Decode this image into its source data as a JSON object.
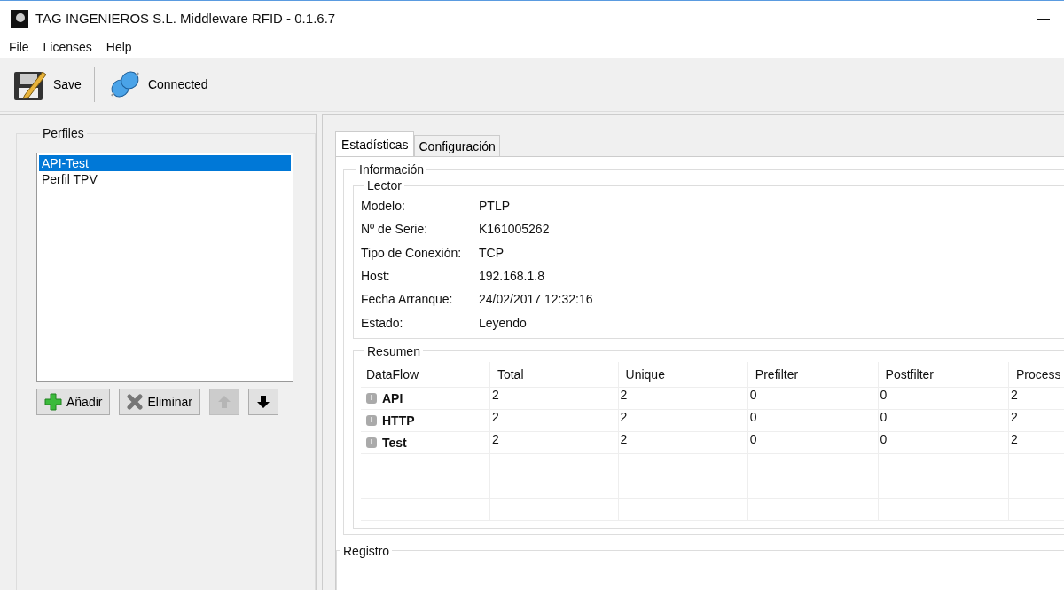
{
  "window": {
    "title": "TAG INGENIEROS S.L. Middleware RFID - 0.1.6.7"
  },
  "menu": [
    "File",
    "Licenses",
    "Help"
  ],
  "toolbar": [
    {
      "kind": "save",
      "label": "Save"
    },
    {
      "kind": "connection",
      "label": "Connected"
    }
  ],
  "profiles": {
    "title": "Perfiles",
    "items": [
      {
        "label": "API-Test",
        "selected": true
      },
      {
        "label": "Perfil TPV",
        "selected": false
      }
    ],
    "buttons": [
      {
        "kind": "add",
        "label": "Añadir",
        "disabled": false
      },
      {
        "kind": "delete",
        "label": "Eliminar",
        "disabled": false
      },
      {
        "kind": "up",
        "disabled": true
      },
      {
        "kind": "down",
        "disabled": false
      }
    ]
  },
  "tabs": [
    {
      "label": "Estadísticas",
      "selected": true
    },
    {
      "label": "Configuración",
      "selected": false
    }
  ],
  "info": {
    "title": "Información",
    "reader": {
      "title": "Lector",
      "fields": [
        {
          "label": "Modelo:",
          "value": "PTLP"
        },
        {
          "label": "Nº de Serie:",
          "value": "K161005262"
        },
        {
          "label": "Tipo de Conexión:",
          "value": "TCP"
        },
        {
          "label": "Host:",
          "value": "192.168.1.8"
        },
        {
          "label": "Fecha Arranque:",
          "value": "24/02/2017 12:32:16"
        },
        {
          "label": "Estado:",
          "value": "Leyendo"
        }
      ]
    }
  },
  "summary": {
    "title": "Resumen",
    "columns": [
      "DataFlow",
      "Total",
      "Unique",
      "Prefilter",
      "Postfilter",
      "Process"
    ],
    "rows": [
      [
        "API",
        "2",
        "2",
        "0",
        "0",
        "2"
      ],
      [
        "HTTP",
        "2",
        "2",
        "0",
        "0",
        "2"
      ],
      [
        "Test",
        "2",
        "2",
        "0",
        "0",
        "2"
      ]
    ]
  },
  "log": {
    "title": "Registro"
  }
}
